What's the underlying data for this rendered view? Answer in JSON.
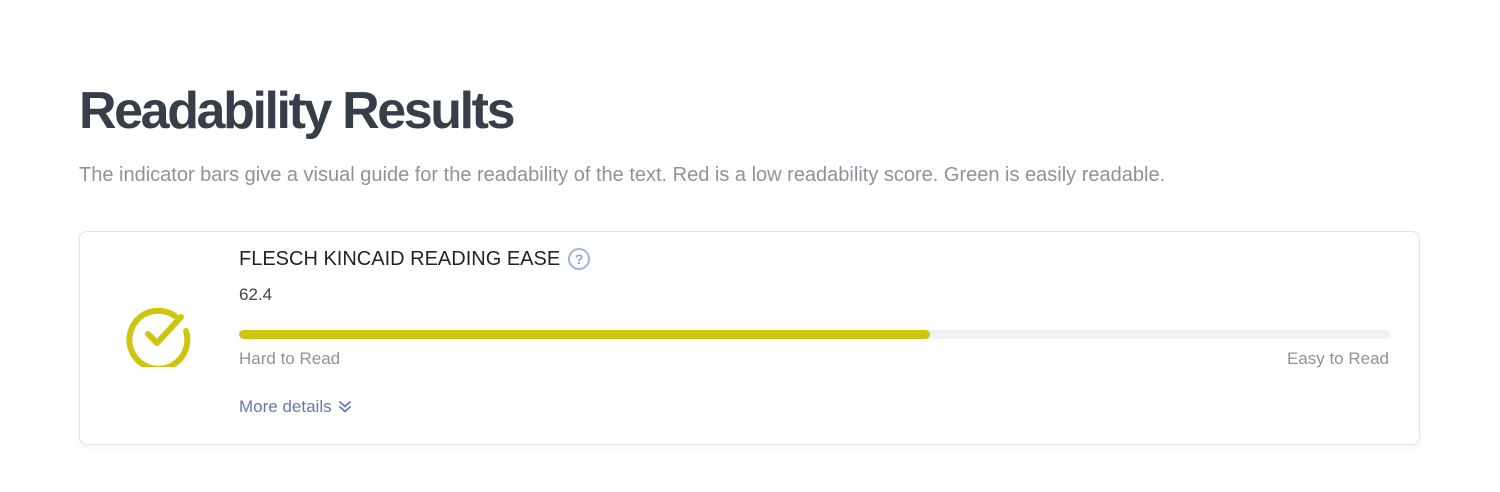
{
  "page": {
    "title": "Readability Results",
    "subtitle": "The indicator bars give a visual guide for the readability of the text. Red is a low readability score. Green is easily readable."
  },
  "metric": {
    "name": "FLESCH KINCAID READING EASE",
    "value": "62.4",
    "progress_percent": 60,
    "min_label": "Hard to Read",
    "max_label": "Easy to Read",
    "more_details_label": "More details",
    "status_icon": "check-circle-icon",
    "help_icon": "question-circle-icon",
    "expand_icon": "double-chevron-down-icon"
  },
  "colors": {
    "status": "#cec60e",
    "link": "#6478b8",
    "help": "#8aa4d1"
  }
}
